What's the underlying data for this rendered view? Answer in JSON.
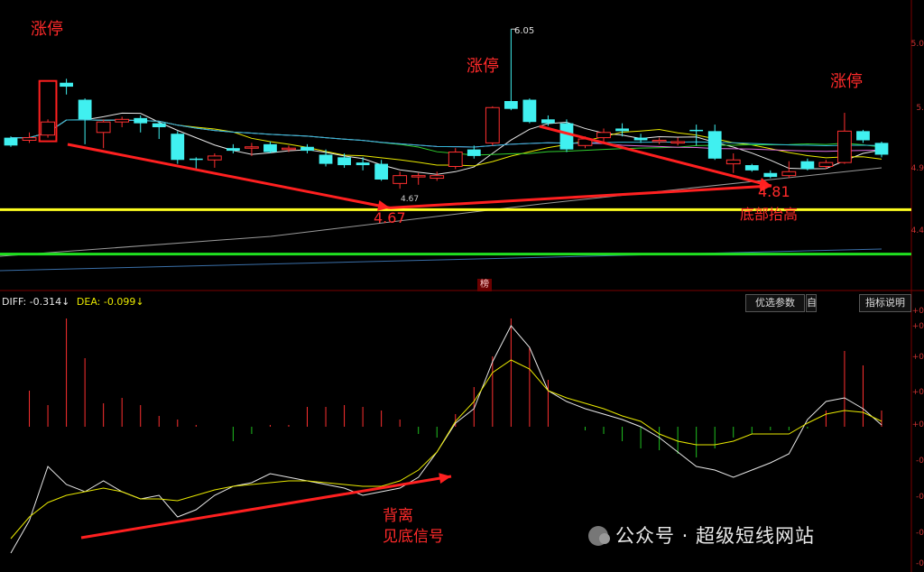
{
  "annotations": {
    "limit_up_1": "涨停",
    "limit_up_2": "涨停",
    "limit_up_3": "涨停",
    "high_value": "6.05",
    "low_small": "4.67",
    "low_1": "4.67",
    "low_2": "4.81",
    "rising_bottom": "底部抬高",
    "divergence_1": "背离",
    "divergence_2": "见底信号"
  },
  "indicator": {
    "diff": "DIFF: -0.314↓",
    "dea": "DEA: -0.099↓",
    "tab_char": "榜"
  },
  "buttons": {
    "select_params": "优选参数",
    "small": "自",
    "indicator_help": "指标说明"
  },
  "price_axis_labels": [
    "5.0",
    "5.",
    "4.9",
    "4.4"
  ],
  "macd_axis_labels": [
    "+0",
    "+0",
    "+0",
    "+0",
    "+0",
    "-0",
    "-0",
    "-0",
    "-0"
  ],
  "watermark": "公众号 · 超级短线网站",
  "colors": {
    "up": "#ff3030",
    "down": "#40f0f0",
    "support_yellow": "#ffff20",
    "support_green": "#20e020",
    "arrow": "#ff2020"
  },
  "chart_data": {
    "type": "candlestick",
    "candles": [
      [
        5.16,
        5.22,
        5.23,
        5.15,
        "down"
      ],
      [
        5.2,
        5.22,
        5.26,
        5.18,
        "up"
      ],
      [
        5.24,
        5.34,
        5.36,
        5.22,
        "up"
      ],
      [
        5.61,
        5.64,
        5.67,
        5.55,
        "down"
      ],
      [
        5.51,
        5.36,
        5.52,
        5.17,
        "down"
      ],
      [
        5.26,
        5.34,
        5.36,
        5.14,
        "up"
      ],
      [
        5.34,
        5.36,
        5.38,
        5.3,
        "up"
      ],
      [
        5.37,
        5.33,
        5.39,
        5.26,
        "down"
      ],
      [
        5.33,
        5.3,
        5.34,
        5.21,
        "down"
      ],
      [
        5.25,
        5.05,
        5.27,
        5.02,
        "down"
      ],
      [
        5.06,
        5.06,
        5.07,
        4.98,
        "down"
      ],
      [
        5.05,
        5.08,
        5.1,
        4.99,
        "up"
      ],
      [
        5.14,
        5.12,
        5.17,
        5.1,
        "down"
      ],
      [
        5.14,
        5.15,
        5.18,
        5.08,
        "up"
      ],
      [
        5.17,
        5.11,
        5.19,
        5.1,
        "down"
      ],
      [
        5.13,
        5.14,
        5.16,
        5.11,
        "up"
      ],
      [
        5.15,
        5.12,
        5.17,
        5.1,
        "down"
      ],
      [
        5.09,
        5.02,
        5.13,
        5.0,
        "down"
      ],
      [
        5.07,
        5.01,
        5.1,
        4.99,
        "down"
      ],
      [
        5.03,
        5.01,
        5.07,
        4.97,
        "down"
      ],
      [
        5.02,
        4.9,
        5.05,
        4.89,
        "down"
      ],
      [
        4.87,
        4.93,
        4.96,
        4.83,
        "up"
      ],
      [
        4.92,
        4.93,
        4.95,
        4.86,
        "up"
      ],
      [
        4.91,
        4.93,
        4.96,
        4.89,
        "up"
      ],
      [
        5.0,
        5.11,
        5.14,
        4.98,
        "up"
      ],
      [
        5.13,
        5.08,
        5.16,
        5.06,
        "down"
      ],
      [
        5.18,
        5.45,
        5.46,
        5.16,
        "up"
      ],
      [
        5.5,
        5.44,
        6.05,
        5.43,
        "down"
      ],
      [
        5.51,
        5.34,
        5.52,
        5.33,
        "down"
      ],
      [
        5.36,
        5.33,
        5.39,
        5.31,
        "down"
      ],
      [
        5.33,
        5.13,
        5.36,
        5.11,
        "down"
      ],
      [
        5.16,
        5.21,
        5.23,
        5.14,
        "up"
      ],
      [
        5.22,
        5.26,
        5.29,
        5.19,
        "up"
      ],
      [
        5.29,
        5.27,
        5.33,
        5.23,
        "down"
      ],
      [
        5.22,
        5.2,
        5.25,
        5.18,
        "down"
      ],
      [
        5.19,
        5.2,
        5.22,
        5.17,
        "up"
      ],
      [
        5.18,
        5.19,
        5.22,
        5.16,
        "up"
      ],
      [
        5.28,
        5.27,
        5.32,
        5.16,
        "down"
      ],
      [
        5.27,
        5.06,
        5.32,
        5.05,
        "down"
      ],
      [
        5.05,
        5.02,
        5.1,
        4.95,
        "up"
      ],
      [
        5.01,
        4.97,
        5.02,
        4.96,
        "down"
      ],
      [
        4.95,
        4.92,
        4.97,
        4.91,
        "down"
      ],
      [
        4.93,
        4.96,
        5.04,
        4.91,
        "up"
      ],
      [
        4.98,
        5.04,
        5.06,
        4.97,
        "down"
      ],
      [
        5.0,
        5.03,
        5.05,
        4.98,
        "up"
      ],
      [
        5.03,
        5.27,
        5.41,
        5.02,
        "up"
      ],
      [
        5.27,
        5.2,
        5.28,
        5.18,
        "down"
      ],
      [
        5.18,
        5.09,
        5.19,
        5.07,
        "down"
      ]
    ],
    "macd_hist": [
      0,
      0.2,
      0.12,
      0.6,
      0.38,
      0.13,
      0.16,
      0.12,
      0.06,
      0.04,
      0.01,
      0.0,
      -0.08,
      -0.04,
      0.01,
      0.01,
      0.11,
      0.11,
      0.12,
      0.11,
      0.09,
      0.04,
      -0.04,
      -0.06,
      0.07,
      0.22,
      0.39,
      0.6,
      0.44,
      0.26,
      0,
      -0.02,
      -0.04,
      -0.08,
      -0.12,
      -0.13,
      -0.15,
      -0.17,
      -0.12,
      -0.06,
      -0.04,
      -0.02,
      -0.02,
      -0.01,
      0.09,
      0.42,
      0.34,
      0.09
    ],
    "diff": [
      -0.7,
      -0.52,
      -0.22,
      -0.32,
      -0.36,
      -0.3,
      -0.36,
      -0.4,
      -0.38,
      -0.5,
      -0.46,
      -0.38,
      -0.33,
      -0.31,
      -0.26,
      -0.28,
      -0.3,
      -0.32,
      -0.34,
      -0.38,
      -0.36,
      -0.34,
      -0.28,
      -0.14,
      0.02,
      0.1,
      0.36,
      0.56,
      0.44,
      0.2,
      0.14,
      0.1,
      0.07,
      0.04,
      0.0,
      -0.06,
      -0.14,
      -0.22,
      -0.24,
      -0.28,
      -0.24,
      -0.2,
      -0.15,
      0.04,
      0.14,
      0.16,
      0.1,
      0.01
    ],
    "dea": [
      -0.62,
      -0.5,
      -0.42,
      -0.38,
      -0.36,
      -0.34,
      -0.36,
      -0.4,
      -0.4,
      -0.41,
      -0.38,
      -0.35,
      -0.33,
      -0.32,
      -0.31,
      -0.3,
      -0.3,
      -0.31,
      -0.32,
      -0.33,
      -0.33,
      -0.3,
      -0.24,
      -0.14,
      0.03,
      0.14,
      0.3,
      0.37,
      0.32,
      0.2,
      0.16,
      0.13,
      0.1,
      0.06,
      0.03,
      -0.04,
      -0.08,
      -0.1,
      -0.1,
      -0.08,
      -0.04,
      -0.04,
      -0.04,
      0.02,
      0.07,
      0.09,
      0.08,
      0.03
    ],
    "support_levels": [
      4.67,
      4.33
    ],
    "key_lows": [
      4.67,
      4.81
    ],
    "ylim": [
      4.1,
      6.1
    ]
  }
}
